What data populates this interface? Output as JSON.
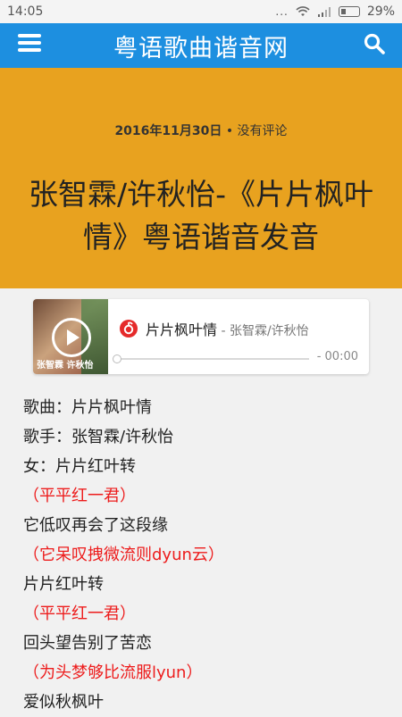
{
  "status": {
    "time": "14:05",
    "dots": "...",
    "battery": "29%"
  },
  "nav": {
    "title": "粤语歌曲谐音网"
  },
  "post": {
    "date": "2016年11月30日",
    "separator": " • ",
    "comments": "没有评论",
    "title": "张智霖/许秋怡-《片片枫叶情》粤语谐音发音"
  },
  "player": {
    "cover_text": "张智霖 许秋怡",
    "song": "片片枫叶情",
    "artist_sep": " - ",
    "artist": "张智霖/许秋怡",
    "time": "- 00:00",
    "progress": 0
  },
  "lyrics": [
    {
      "text": "歌曲：片片枫叶情",
      "type": "normal"
    },
    {
      "text": "歌手：张智霖/许秋怡",
      "type": "normal"
    },
    {
      "text": "女：片片红叶转",
      "type": "normal"
    },
    {
      "text": "（平平红一君）",
      "type": "red"
    },
    {
      "text": "它低叹再会了这段缘",
      "type": "normal"
    },
    {
      "text": "（它呆叹拽微流则dyun云）",
      "type": "red"
    },
    {
      "text": "片片红叶转",
      "type": "normal"
    },
    {
      "text": "（平平红一君）",
      "type": "red"
    },
    {
      "text": "回头望告别了苦恋",
      "type": "normal"
    },
    {
      "text": "（为头梦够比流服lyun）",
      "type": "red"
    },
    {
      "text": "爱似秋枫叶",
      "type": "normal"
    }
  ],
  "colors": {
    "nav": "#1d8fe0",
    "hero": "#e8a21f",
    "lyrics_red": "#ed1c1c"
  }
}
